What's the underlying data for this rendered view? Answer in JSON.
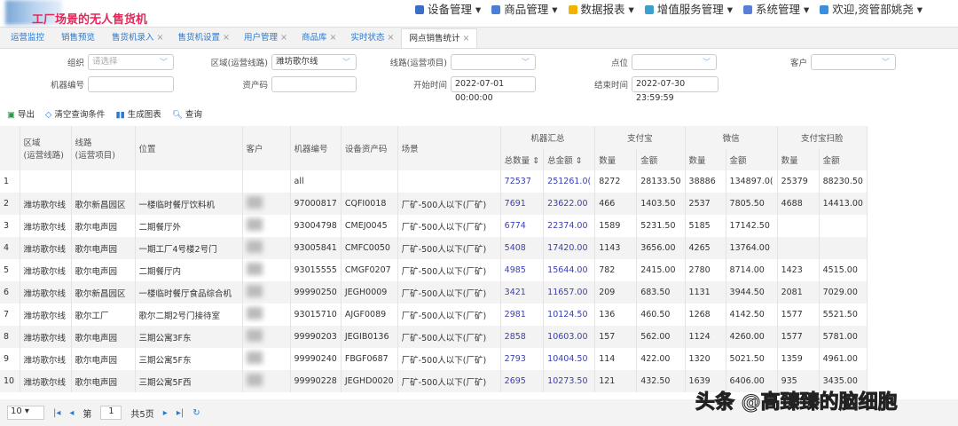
{
  "header": {
    "title": "工厂场景的无人售货机",
    "nav": [
      {
        "label": "设备管理 ▾",
        "color": "#3a6fc7"
      },
      {
        "label": "商品管理 ▾",
        "color": "#4a7fd4"
      },
      {
        "label": "数据报表 ▾",
        "color": "#f0b400"
      },
      {
        "label": "增值服务管理 ▾",
        "color": "#3aa0d0"
      },
      {
        "label": "系统管理 ▾",
        "color": "#5a7fd8"
      },
      {
        "label": "欢迎,资管部姚尧 ▾",
        "color": "#3a8fe0"
      }
    ]
  },
  "tabs": [
    {
      "label": "运营监控",
      "close": ""
    },
    {
      "label": "销售预览",
      "close": ""
    },
    {
      "label": "售货机录入",
      "close": "×"
    },
    {
      "label": "售货机设置",
      "close": "×"
    },
    {
      "label": "用户管理",
      "close": "×"
    },
    {
      "label": "商品库",
      "close": "×"
    },
    {
      "label": "实时状态",
      "close": "×"
    },
    {
      "label": "网点销售统计",
      "close": "×"
    }
  ],
  "filters": {
    "org_label": "组织",
    "org_placeholder": "请选择",
    "area_label": "区域(运营线路)",
    "area_value": "潍坊歌尔线",
    "line_label": "线路(运营项目)",
    "point_label": "点位",
    "customer_label": "客户",
    "machine_label": "机器编号",
    "asset_label": "资产码",
    "start_label": "开始时间",
    "start_value": "2022-07-01 00:00:00",
    "end_label": "结束时间",
    "end_value": "2022-07-30 23:59:59"
  },
  "toolbar": {
    "export": "导出",
    "clear": "清空查询条件",
    "chart": "生成图表",
    "query": "查询"
  },
  "table": {
    "groups": {
      "machine": "机器汇总",
      "alipay": "支付宝",
      "wechat": "微信",
      "face": "支付宝扫脸"
    },
    "headers": {
      "area": "区域\n(运营线路)",
      "line": "线路\n(运营项目)",
      "pos": "位置",
      "cust": "客户",
      "mno": "机器编号",
      "asset": "设备资产码",
      "scene": "场景",
      "tq": "总数量 ⇕",
      "ta": "总金额 ⇕",
      "q": "数量",
      "a": "金额"
    },
    "rows": [
      [
        "1",
        "",
        "",
        "",
        "",
        "all",
        "",
        "",
        "72537",
        "251261.0(",
        "8272",
        "28133.50",
        "38886",
        "134897.0(",
        "25379",
        "88230.50"
      ],
      [
        "2",
        "潍坊歌尔线",
        "歌尔新昌园区",
        "一楼临时餐厅饮料机",
        "",
        "97000817",
        "CQFI0018",
        "厂矿-500人以下(厂矿)",
        "7691",
        "23622.00",
        "466",
        "1403.50",
        "2537",
        "7805.50",
        "4688",
        "14413.00"
      ],
      [
        "3",
        "潍坊歌尔线",
        "歌尔电声园",
        "二期餐厅外",
        "",
        "93004798",
        "CMEJ0045",
        "厂矿-500人以下(厂矿)",
        "6774",
        "22374.00",
        "1589",
        "5231.50",
        "5185",
        "17142.50",
        "",
        ""
      ],
      [
        "4",
        "潍坊歌尔线",
        "歌尔电声园",
        "一期工厂4号楼2号门",
        "",
        "93005841",
        "CMFC0050",
        "厂矿-500人以下(厂矿)",
        "5408",
        "17420.00",
        "1143",
        "3656.00",
        "4265",
        "13764.00",
        "",
        ""
      ],
      [
        "5",
        "潍坊歌尔线",
        "歌尔电声园",
        "二期餐厅内",
        "",
        "93015555",
        "CMGF0207",
        "厂矿-500人以下(厂矿)",
        "4985",
        "15644.00",
        "782",
        "2415.00",
        "2780",
        "8714.00",
        "1423",
        "4515.00"
      ],
      [
        "6",
        "潍坊歌尔线",
        "歌尔新昌园区",
        "一楼临时餐厅食品综合机",
        "",
        "99990250",
        "JEGH0009",
        "厂矿-500人以下(厂矿)",
        "3421",
        "11657.00",
        "209",
        "683.50",
        "1131",
        "3944.50",
        "2081",
        "7029.00"
      ],
      [
        "7",
        "潍坊歌尔线",
        "歌尔工厂",
        "歌尔二期2号门接待室",
        "",
        "93015710",
        "AJGF0089",
        "厂矿-500人以下(厂矿)",
        "2981",
        "10124.50",
        "136",
        "460.50",
        "1268",
        "4142.50",
        "1577",
        "5521.50"
      ],
      [
        "8",
        "潍坊歌尔线",
        "歌尔电声园",
        "三期公寓3F东",
        "",
        "99990203",
        "JEGIB0136",
        "厂矿-500人以下(厂矿)",
        "2858",
        "10603.00",
        "157",
        "562.00",
        "1124",
        "4260.00",
        "1577",
        "5781.00"
      ],
      [
        "9",
        "潍坊歌尔线",
        "歌尔电声园",
        "三期公寓5F东",
        "",
        "99990240",
        "FBGF0687",
        "厂矿-500人以下(厂矿)",
        "2793",
        "10404.50",
        "114",
        "422.00",
        "1320",
        "5021.50",
        "1359",
        "4961.00"
      ],
      [
        "10",
        "潍坊歌尔线",
        "歌尔电声园",
        "三期公寓5F西",
        "",
        "99990228",
        "JEGHD0020",
        "厂矿-500人以下(厂矿)",
        "2695",
        "10273.50",
        "121",
        "432.50",
        "1639",
        "6406.00",
        "935",
        "3435.00"
      ]
    ]
  },
  "pager": {
    "page_size": "10",
    "page_prefix": "第",
    "page": "1",
    "total": "共5页"
  },
  "watermark": "头条 @高臻臻的脑细胞"
}
